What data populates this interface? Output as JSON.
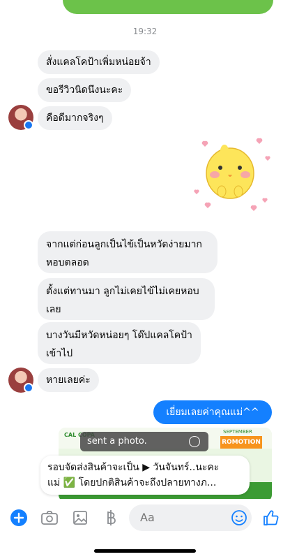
{
  "header": {
    "timestamp": "19:32"
  },
  "messages": {
    "m1": "สั่งแคลโคป้าเพิ่มหน่อยจ้า",
    "m2": "ขอรีวิวนิดนึงนะคะ",
    "m3": "คือดีมากจริงๆ",
    "m4_l1": "จากแต่ก่อนลูกเป็นไข้เป็นหวัดง่ายมาก",
    "m4_l2": "หอบตลอด",
    "m5_l1": "ตั้งแต่ทานมา ลูกไม่เคยไข้ไม่เคยหอบ",
    "m5_l2": "เลย",
    "m6_l1": "บางวันมีหวัดหน่อยๆ โด๊ปแคลโคป้า",
    "m6_l2": "เข้าไป",
    "m7": "หายเลยค่ะ",
    "sent": "เยี่ยมเลยค่าคุณแม่^^"
  },
  "photo": {
    "brand": "CAL COPA",
    "promo": "ROMOTION",
    "promo_sub": "SEPTEMBER",
    "sent_label": "sent a photo."
  },
  "caption": {
    "line1": "รอบจัดส่งสินค้าจะเป็น ▶ วันจันทร์..นะคะ",
    "line2": "แม่ ✅ โดยปกติสินค้าจะถึงปลายทางภ..."
  },
  "composer": {
    "placeholder": "Aa",
    "icons": [
      "plus-icon",
      "camera-icon",
      "gallery-icon",
      "baht-icon",
      "emoji-icon",
      "like-icon"
    ]
  },
  "colors": {
    "accent": "#1480ff",
    "incoming": "#eff0f2",
    "messenger_blue": "#1877f2"
  }
}
